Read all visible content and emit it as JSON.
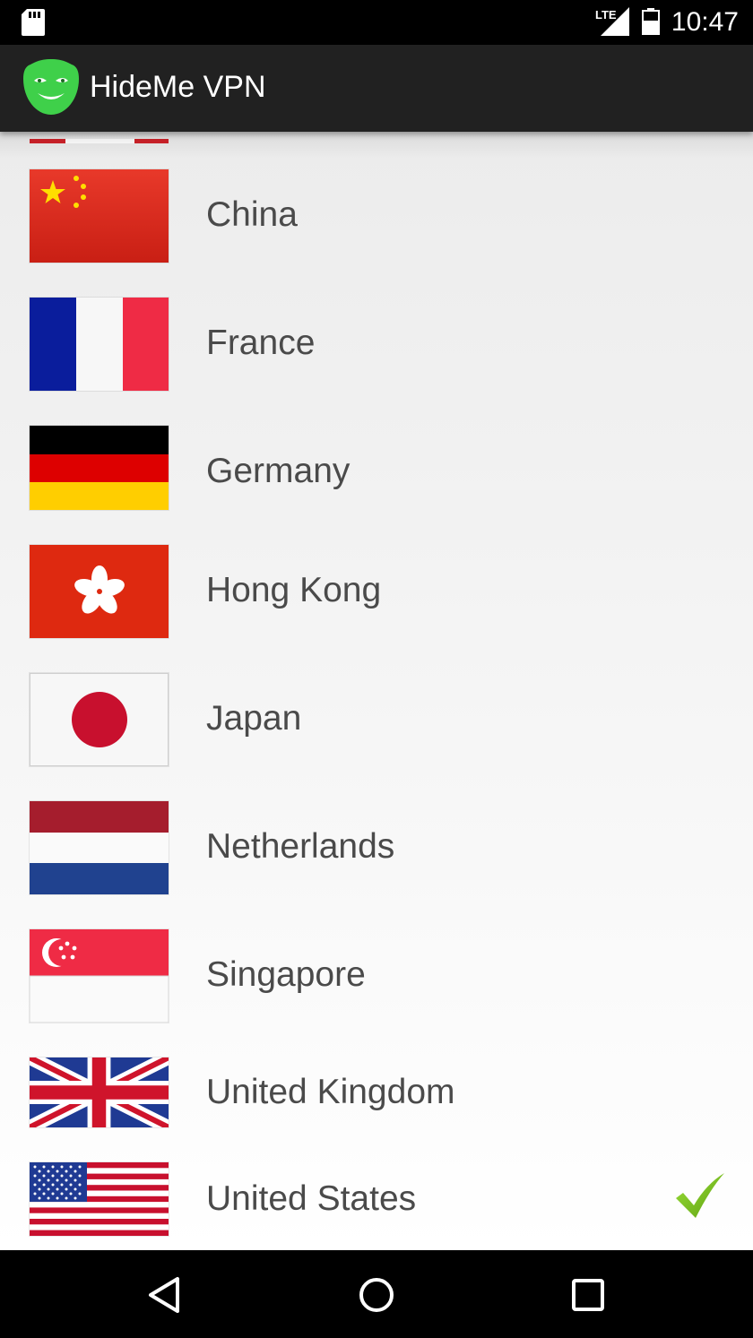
{
  "status_bar": {
    "time": "10:47",
    "network": "LTE",
    "icons": [
      "sd-card-icon",
      "lte-signal-icon",
      "battery-icon"
    ]
  },
  "app_bar": {
    "title": "HideMe VPN",
    "logo_icon": "mask-logo-icon",
    "logo_color": "#3fd04a"
  },
  "countries": [
    {
      "name": "China",
      "flag": "china-flag-icon",
      "selected": false
    },
    {
      "name": "France",
      "flag": "france-flag-icon",
      "selected": false
    },
    {
      "name": "Germany",
      "flag": "germany-flag-icon",
      "selected": false
    },
    {
      "name": "Hong Kong",
      "flag": "hong-kong-flag-icon",
      "selected": false
    },
    {
      "name": "Japan",
      "flag": "japan-flag-icon",
      "selected": false
    },
    {
      "name": "Netherlands",
      "flag": "netherlands-flag-icon",
      "selected": false
    },
    {
      "name": "Singapore",
      "flag": "singapore-flag-icon",
      "selected": false
    },
    {
      "name": "United Kingdom",
      "flag": "uk-flag-icon",
      "selected": false
    },
    {
      "name": "United States",
      "flag": "us-flag-icon",
      "selected": true
    }
  ],
  "selection_icon": "checkmark-icon",
  "selection_color": "#7cc21f",
  "nav_bar": {
    "buttons": [
      "back-icon",
      "home-icon",
      "recents-icon"
    ]
  }
}
